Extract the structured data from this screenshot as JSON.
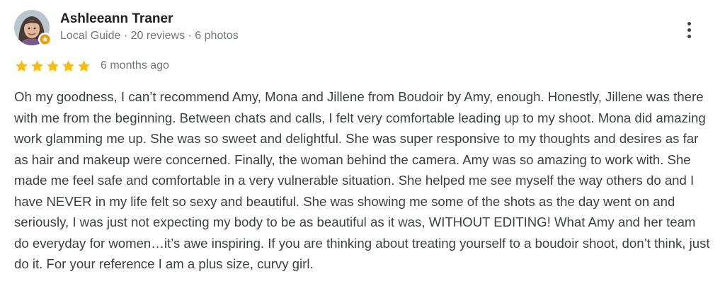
{
  "reviewer": {
    "name": "Ashleeann Traner",
    "meta": "Local Guide · 20 reviews · 6 photos"
  },
  "rating": {
    "stars": 5,
    "max": 5,
    "date": "6 months ago"
  },
  "review": {
    "text": "Oh my goodness, I can’t recommend Amy, Mona and Jillene from Boudoir by Amy, enough. Honestly, Jillene was there with me from the beginning. Between chats and calls, I felt very comfortable leading up to my shoot. Mona did amazing work glamming me up. She was so sweet and delightful. She was super responsive to my thoughts and desires as far as hair and makeup were concerned. Finally, the woman behind the camera. Amy was so amazing to work with. She made me feel safe and comfortable in a very vulnerable situation. She helped me see myself the way others do and I have NEVER in my life felt so sexy and beautiful. She was showing me some of the shots as the day went on and seriously, I was just not expecting my body to be as beautiful as it was, WITHOUT EDITING! What Amy and her team do everyday for women…it’s awe inspiring. If you are thinking about treating yourself to a boudoir shoot, don’t think, just do it. For your reference I am a plus size, curvy girl."
  },
  "icons": {
    "more": "more-vert-icon",
    "star": "star-icon",
    "badge": "local-guide-badge-icon"
  },
  "colors": {
    "star": "#fbbc04",
    "badge": "#f29900",
    "name": "#202124",
    "meta": "#70757a",
    "body": "#3c4043"
  }
}
